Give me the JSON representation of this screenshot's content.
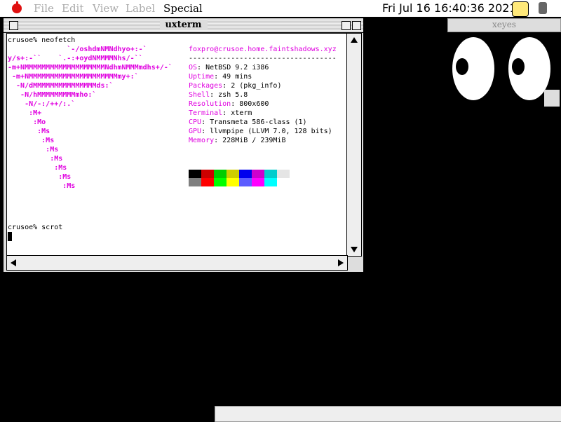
{
  "menubar": {
    "items": [
      "File",
      "Edit",
      "View",
      "Label",
      "Special"
    ],
    "clock": "Fri Jul 16 16:40:36 2021"
  },
  "window": {
    "title": "uxterm"
  },
  "terminal": {
    "cmd1": "crusoe% neofetch",
    "cmd2": "crusoe% scrot",
    "userhost": "foxpro@crusoe.home.faintshadows.xyz",
    "separator": "-----------------------------------",
    "info": [
      {
        "label": "OS",
        "value": ": NetBSD 9.2 i386"
      },
      {
        "label": "Uptime",
        "value": ": 49 mins"
      },
      {
        "label": "Packages",
        "value": ": 2 (pkg_info)"
      },
      {
        "label": "Shell",
        "value": ": zsh 5.8"
      },
      {
        "label": "Resolution",
        "value": ": 800x600"
      },
      {
        "label": "Terminal",
        "value": ": xterm"
      },
      {
        "label": "CPU",
        "value": ": Transmeta 586-class (1)"
      },
      {
        "label": "GPU",
        "value": ": llvmpipe (LLVM 7.0, 128 bits)"
      },
      {
        "label": "Memory",
        "value": ": 228MiB / 239MiB"
      }
    ],
    "logo": [
      "              `-/oshdmNMNdhyo+:-`",
      "y/s+:-``    `.-:+oydNMMMMNhs/-``",
      "-m+NMMMMMMMMMMMMMMMMMMMNdhmNMMMmdhs+/-`",
      " -m+NMMMMMMMMMMMMMMMMMMMMMmy+:`",
      "  -N/dMMMMMMMMMMMMMMMds:`",
      "   -N/hMMMMMMMMMmho:`",
      "    -N/-:/++/:.`",
      "     :M+",
      "      :Mo",
      "       :Ms",
      "        :Ms",
      "         :Ms",
      "          :Ms",
      "           :Ms",
      "            :Ms",
      "             :Ms"
    ],
    "colors_row1": [
      "#000000",
      "#cd0000",
      "#00cd00",
      "#cdcd00",
      "#0000ee",
      "#cd00cd",
      "#00cdcd",
      "#e5e5e5"
    ],
    "colors_row2": [
      "#7f7f7f",
      "#ff0000",
      "#00ff00",
      "#ffff00",
      "#5c5cff",
      "#ff00ff",
      "#00ffff",
      "#ffffff"
    ]
  },
  "xeyes": {
    "title": "xeyes"
  }
}
